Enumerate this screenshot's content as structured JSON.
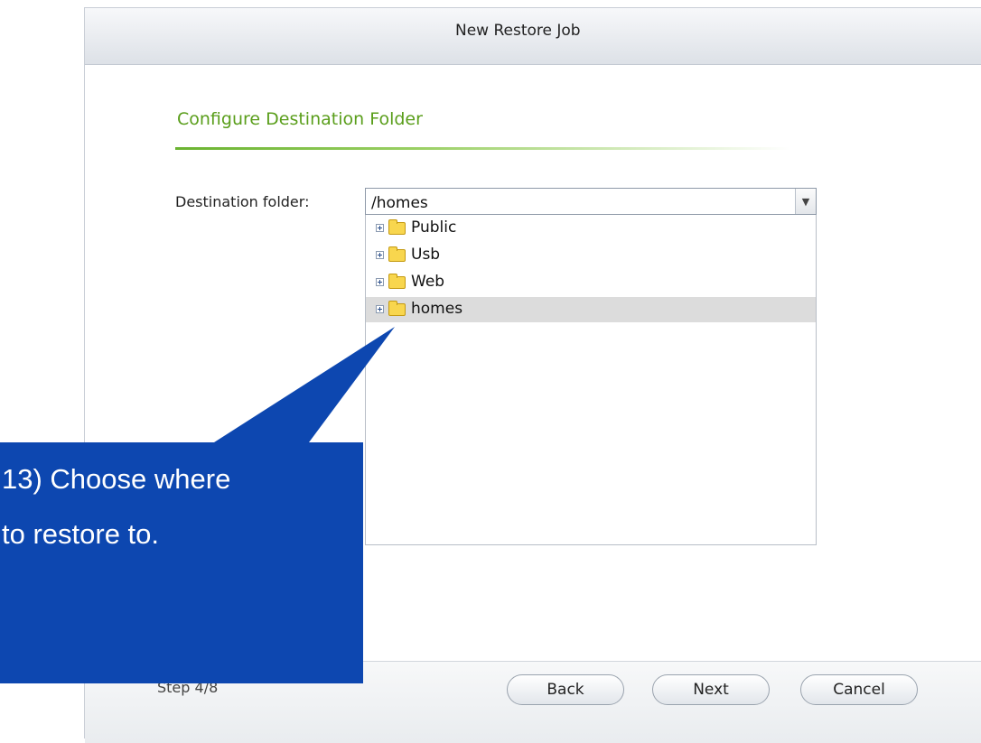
{
  "dialog": {
    "title": "New Restore Job",
    "section_title": "Configure Destination Folder",
    "destination_label": "Destination folder:",
    "destination_value": "/homes",
    "tree_items": [
      {
        "label": "Public",
        "selected": false
      },
      {
        "label": "Usb",
        "selected": false
      },
      {
        "label": "Web",
        "selected": false
      },
      {
        "label": "homes",
        "selected": true
      }
    ],
    "step": "Step 4/8",
    "buttons": {
      "back": "Back",
      "next": "Next",
      "cancel": "Cancel"
    }
  },
  "callout": {
    "line1": "13) Choose where",
    "line2": "to restore to.",
    "color": "#0d47b0"
  },
  "colors": {
    "accent_green": "#5a9e1b",
    "selected_row": "#dcdcdc"
  },
  "icons": [
    "folder-icon",
    "expand-plus-icon",
    "chevron-down-icon"
  ]
}
